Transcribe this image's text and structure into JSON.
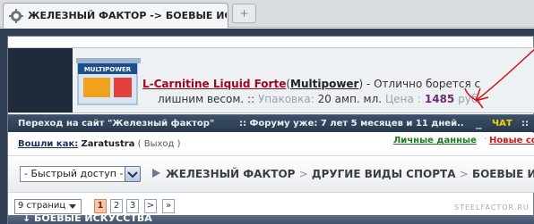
{
  "browser": {
    "tab_title": "ЖЕЛЕЗНЫЙ ФАКТОР -> БОЕВЫЕ ИСК...",
    "new_tab_symbol": "+",
    "favicon": "gear-shield-icon"
  },
  "ad": {
    "product_link": "L-Carnitine Liquid Forte",
    "brand_open": "(",
    "brand_link": "Multipower",
    "brand_close": ")",
    "tagline_start": " - Отлично борется с",
    "tagline_end": "лишним весом.",
    "sep": " :: ",
    "pack_label": "Упаковка:",
    "pack_value": " 20 амп. мл.",
    "price_label": "Цена :",
    "price_value": " 1485",
    "currency": " руб.",
    "image": "multipower-product-box"
  },
  "infobar": {
    "goto_site": "Переход на сайт \"Железный фактор\"",
    "forum_age": ":: Форуму уже: 7 лет 5 месяцев и 11 дней..",
    "cursor": "_",
    "chat": "ЧАТ",
    "separator": "::"
  },
  "login": {
    "label": "Вошли как:",
    "username": "Zaratustra",
    "logout": "( Выход )",
    "personal_data": "Личные данные",
    "new": "Новые со"
  },
  "nav": {
    "quick_access": "- Быстрый доступ -",
    "crumbs": [
      "ЖЕЛЕЗНЫЙ ФАКТОР",
      "ДРУГИЕ ВИДЫ СПОРТА",
      "БОЕВЫЕ И"
    ],
    "crumb_sep": ">"
  },
  "pager": {
    "pages_select": "9 страниц",
    "buttons": [
      "1",
      "2",
      "3",
      ">",
      "»"
    ],
    "current": "1"
  },
  "footer": {
    "site_url": "STEELFACTOR.RU",
    "forum_title": "БОЕВЫЕ ИСКУССТВА"
  },
  "colors": {
    "accent_red": "#a3051f",
    "header_blue": "#2f3e52",
    "price_purple": "#6d2a73",
    "chat_yellow": "#f2d20a",
    "annotation_red": "#d01010"
  }
}
